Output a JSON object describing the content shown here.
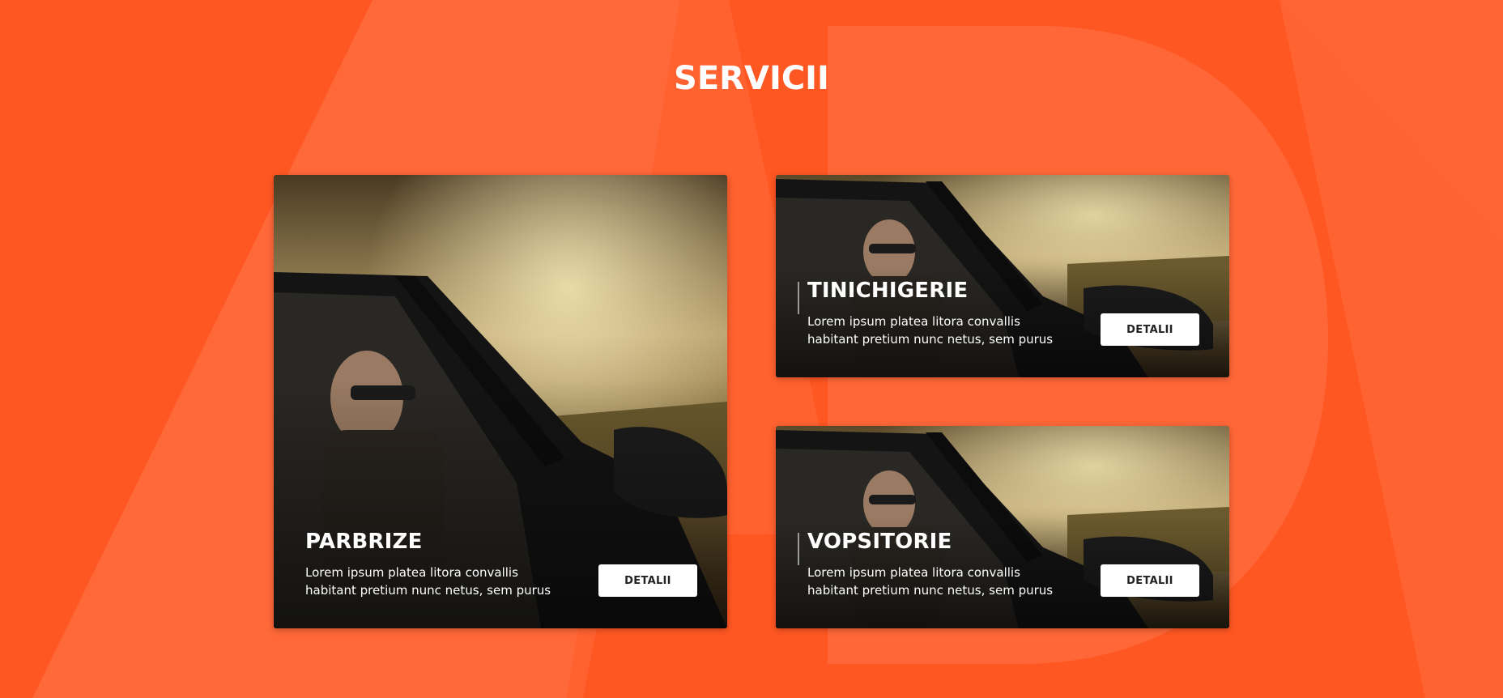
{
  "page": {
    "title": "SERVICII"
  },
  "colors": {
    "accent": "#FF5722",
    "button_bg": "#ffffff",
    "text_light": "#ffffff"
  },
  "services": [
    {
      "title": "PARBRIZE",
      "description": "Lorem ipsum platea litora convallis habitant pretium nunc netus, sem purus",
      "button_label": "DETALII"
    },
    {
      "title": "TINICHIGERIE",
      "description": "Lorem ipsum platea litora convallis habitant pretium nunc netus, sem purus",
      "button_label": "DETALII"
    },
    {
      "title": "VOPSITORIE",
      "description": "Lorem ipsum platea litora convallis habitant pretium nunc netus, sem purus",
      "button_label": "DETALII"
    }
  ]
}
